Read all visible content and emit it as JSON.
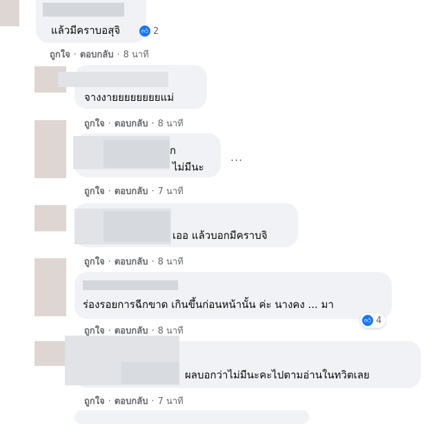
{
  "comments": [
    {
      "text": "แล้วมีคราบอสุจิ",
      "reactions": "2"
    },
    {
      "text": "จางงายยยยยยยยแม่"
    },
    {
      "text_top": "ก",
      "text": "ไม่มีนะ"
    },
    {
      "text": "เออ แล้วบอกมีคราบจิ"
    },
    {
      "text": "ร่องรอยการฉีกขาด เกินขึ้นก่อนหน้านั้น ค่ะ นางคง ... มา",
      "reactions": "4"
    },
    {
      "text": "ผลบอกว่าไม่มีนะคะไปตามอ่านในทวิตเลย"
    }
  ],
  "actions": {
    "like": "ถูกใจ",
    "reply": "ตอบกลับ",
    "dot": "·"
  },
  "times": [
    "8 นาที",
    "8 นาที",
    "7 นาที",
    "8 นาที",
    "8 นาที",
    "7 นาที"
  ],
  "more_label": "...",
  "like_icon": "like-icon",
  "accent": "#1877f2"
}
